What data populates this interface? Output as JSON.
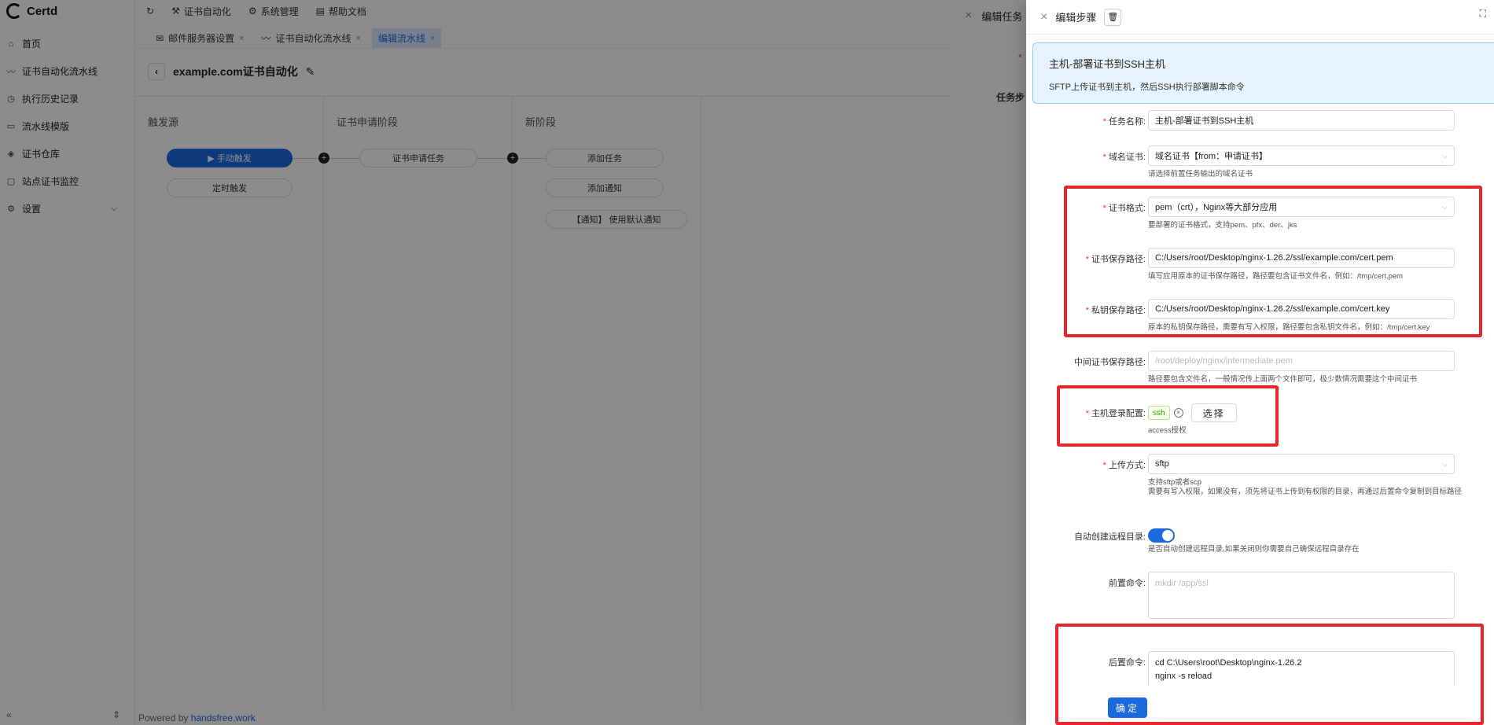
{
  "app": {
    "logo_text": "Certd",
    "menu": [
      {
        "icon": "⌂",
        "label": "首页"
      },
      {
        "icon": "〰",
        "label": "证书自动化流水线"
      },
      {
        "icon": "◷",
        "label": "执行历史记录"
      },
      {
        "icon": "▭",
        "label": "流水线模版"
      },
      {
        "icon": "◈",
        "label": "证书仓库"
      },
      {
        "icon": "▢",
        "label": "站点证书监控"
      },
      {
        "icon": "⚙",
        "label": "设置"
      }
    ],
    "footer_left": "«",
    "footer_right": "⇕"
  },
  "topbar": {
    "refresh_icon": "↻",
    "items": [
      {
        "icon": "⚒",
        "label": "证书自动化"
      },
      {
        "icon": "⚙",
        "label": "系统管理"
      },
      {
        "icon": "▤",
        "label": "帮助文档"
      }
    ]
  },
  "tabs": [
    {
      "icon": "✉",
      "label": "邮件服务器设置",
      "close": "×"
    },
    {
      "icon": "〰",
      "label": "证书自动化流水线",
      "close": "×"
    },
    {
      "icon": "",
      "label": "编辑流水线",
      "close": "×"
    }
  ],
  "page": {
    "back": "‹",
    "title": "example.com证书自动化",
    "edit_icon": "✎"
  },
  "canvas": {
    "col1_title": "触发源",
    "col2_title": "证书申请阶段",
    "col3_title": "新阶段",
    "manual_trigger": "▶ 手动触发",
    "timer_trigger": "定时触发",
    "cert_task": "证书申请任务",
    "add_task": "添加任务",
    "add_notify": "添加通知",
    "notify_default": "【通知】 使用默认通知",
    "plus": "+"
  },
  "powered": {
    "prefix": "Powered by ",
    "link": "handsfree.work"
  },
  "outer_drawer": {
    "title": "编辑任务",
    "close": "×",
    "label_b": "任务步"
  },
  "drawer": {
    "title": "编辑步骤",
    "close": "×",
    "trash": "🗑",
    "fullscreen": "⛶",
    "info_title": "主机-部署证书到SSH主机",
    "info_desc": "SFTP上传证书到主机，然后SSH执行部署脚本命令",
    "fields": {
      "task_name": {
        "label": "任务名称:",
        "value": "主机-部署证书到SSH主机"
      },
      "domain_cert": {
        "label": "域名证书:",
        "value": "域名证书【from：申请证书】",
        "help": "请选择前置任务输出的域名证书"
      },
      "cert_format": {
        "label": "证书格式:",
        "value": "pem（crt），Nginx等大部分应用",
        "help": "要部署的证书格式，支持pem、pfx、der、jks"
      },
      "cert_path": {
        "label": "证书保存路径:",
        "value": "C:/Users/root/Desktop/nginx-1.26.2/ssl/example.com/cert.pem",
        "help": "填写应用原本的证书保存路径，路径要包含证书文件名，例如：/tmp/cert.pem"
      },
      "key_path": {
        "label": "私钥保存路径:",
        "value": "C:/Users/root/Desktop/nginx-1.26.2/ssl/example.com/cert.key",
        "help": "原本的私钥保存路径，需要有写入权限，路径要包含私钥文件名，例如：/tmp/cert.key"
      },
      "intermediate_path": {
        "label": "中间证书保存路径:",
        "placeholder": "/root/deploy/nginx/intermediate.pem",
        "help": "路径要包含文件名，一般情况传上面两个文件即可，极少数情况需要这个中间证书"
      },
      "host_login": {
        "label": "主机登录配置:",
        "tag": "ssh",
        "clear": "×",
        "button": "选择",
        "help": "access授权"
      },
      "upload_method": {
        "label": "上传方式:",
        "value": "sftp",
        "help1": "支持sftp或者scp",
        "help2": "需要有写入权限，如果没有，须先将证书上传到有权限的目录，再通过后置命令复制到目标路径"
      },
      "auto_mkdir": {
        "label": "自动创建远程目录:",
        "help": "是否自动创建远程目录,如果关闭则你需要自己确保远程目录存在"
      },
      "pre_cmd": {
        "label": "前置命令:",
        "placeholder": "mkdir /app/ssl"
      },
      "post_cmd": {
        "label": "后置命令:",
        "line1": "cd C:\\Users\\root\\Desktop\\nginx-1.26.2",
        "line2": "nginx -s reload"
      }
    },
    "ok": "确定",
    "arrow": "⌵"
  }
}
